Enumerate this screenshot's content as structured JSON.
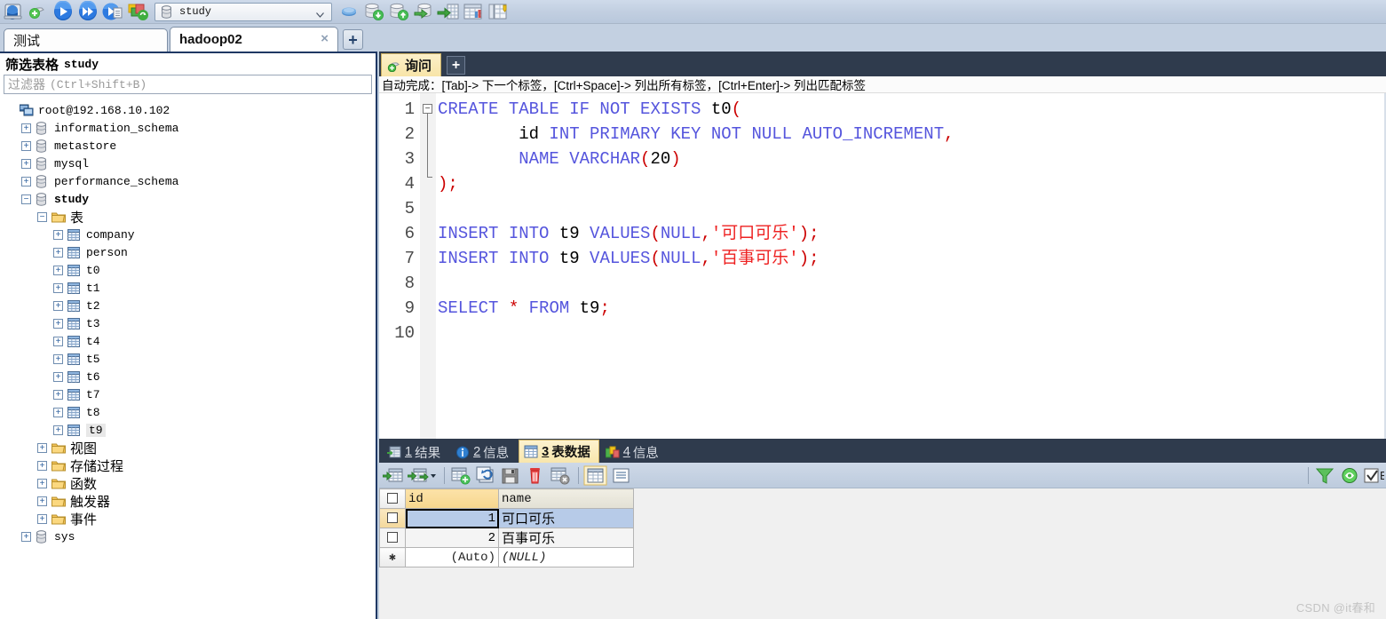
{
  "toolbar": {
    "icons": [
      {
        "name": "connection-manager-icon"
      },
      {
        "name": "new-query-icon"
      },
      {
        "name": "execute-icon"
      },
      {
        "name": "execute-all-icon"
      },
      {
        "name": "execute-selection-icon"
      },
      {
        "name": "stop-icon"
      }
    ],
    "database_selector": {
      "value": "study",
      "icon": "database-icon",
      "caret": "chevron-down-icon"
    },
    "right_icons": [
      {
        "name": "flush-icon"
      },
      {
        "name": "import-database-icon"
      },
      {
        "name": "export-database-icon"
      },
      {
        "name": "export-grid-icon"
      },
      {
        "name": "import-csv-icon"
      },
      {
        "name": "table-tools-icon"
      },
      {
        "name": "bulk-table-editor-icon"
      }
    ]
  },
  "connection_tabs": {
    "tabs": [
      {
        "label": "测试",
        "active": false,
        "closable": false
      },
      {
        "label": "hadoop02",
        "active": true,
        "closable": true,
        "close_glyph": "×"
      }
    ],
    "new_tab_label": "+"
  },
  "sidebar": {
    "title_zh": "筛选表格",
    "title_db": "study",
    "filter_placeholder_zh": "过滤器",
    "filter_placeholder_hint": "(Ctrl+Shift+B)",
    "tree": [
      {
        "label": "root@192.168.10.102",
        "icon": "server-icon",
        "indent": 0,
        "expander": "",
        "bold": false,
        "zh": false,
        "selected": false
      },
      {
        "label": "information_schema",
        "icon": "database-icon",
        "indent": 1,
        "expander": "+",
        "bold": false,
        "zh": false,
        "selected": false
      },
      {
        "label": "metastore",
        "icon": "database-icon",
        "indent": 1,
        "expander": "+",
        "bold": false,
        "zh": false,
        "selected": false
      },
      {
        "label": "mysql",
        "icon": "database-icon",
        "indent": 1,
        "expander": "+",
        "bold": false,
        "zh": false,
        "selected": false
      },
      {
        "label": "performance_schema",
        "icon": "database-icon",
        "indent": 1,
        "expander": "+",
        "bold": false,
        "zh": false,
        "selected": false
      },
      {
        "label": "study",
        "icon": "database-icon",
        "indent": 1,
        "expander": "-",
        "bold": true,
        "zh": false,
        "selected": false
      },
      {
        "label": "表",
        "icon": "folder-icon",
        "indent": 2,
        "expander": "-",
        "bold": false,
        "zh": true,
        "selected": false
      },
      {
        "label": "company",
        "icon": "table-icon",
        "indent": 3,
        "expander": "+",
        "bold": false,
        "zh": false,
        "selected": false
      },
      {
        "label": "person",
        "icon": "table-icon",
        "indent": 3,
        "expander": "+",
        "bold": false,
        "zh": false,
        "selected": false
      },
      {
        "label": "t0",
        "icon": "table-icon",
        "indent": 3,
        "expander": "+",
        "bold": false,
        "zh": false,
        "selected": false
      },
      {
        "label": "t1",
        "icon": "table-icon",
        "indent": 3,
        "expander": "+",
        "bold": false,
        "zh": false,
        "selected": false
      },
      {
        "label": "t2",
        "icon": "table-icon",
        "indent": 3,
        "expander": "+",
        "bold": false,
        "zh": false,
        "selected": false
      },
      {
        "label": "t3",
        "icon": "table-icon",
        "indent": 3,
        "expander": "+",
        "bold": false,
        "zh": false,
        "selected": false
      },
      {
        "label": "t4",
        "icon": "table-icon",
        "indent": 3,
        "expander": "+",
        "bold": false,
        "zh": false,
        "selected": false
      },
      {
        "label": "t5",
        "icon": "table-icon",
        "indent": 3,
        "expander": "+",
        "bold": false,
        "zh": false,
        "selected": false
      },
      {
        "label": "t6",
        "icon": "table-icon",
        "indent": 3,
        "expander": "+",
        "bold": false,
        "zh": false,
        "selected": false
      },
      {
        "label": "t7",
        "icon": "table-icon",
        "indent": 3,
        "expander": "+",
        "bold": false,
        "zh": false,
        "selected": false
      },
      {
        "label": "t8",
        "icon": "table-icon",
        "indent": 3,
        "expander": "+",
        "bold": false,
        "zh": false,
        "selected": false
      },
      {
        "label": "t9",
        "icon": "table-icon",
        "indent": 3,
        "expander": "+",
        "bold": false,
        "zh": false,
        "selected": true
      },
      {
        "label": "视图",
        "icon": "folder-icon",
        "indent": 2,
        "expander": "+",
        "bold": false,
        "zh": true,
        "selected": false
      },
      {
        "label": "存储过程",
        "icon": "folder-icon",
        "indent": 2,
        "expander": "+",
        "bold": false,
        "zh": true,
        "selected": false
      },
      {
        "label": "函数",
        "icon": "folder-icon",
        "indent": 2,
        "expander": "+",
        "bold": false,
        "zh": true,
        "selected": false
      },
      {
        "label": "触发器",
        "icon": "folder-icon",
        "indent": 2,
        "expander": "+",
        "bold": false,
        "zh": true,
        "selected": false
      },
      {
        "label": "事件",
        "icon": "folder-icon",
        "indent": 2,
        "expander": "+",
        "bold": false,
        "zh": true,
        "selected": false
      },
      {
        "label": "sys",
        "icon": "database-icon",
        "indent": 1,
        "expander": "+",
        "bold": false,
        "zh": false,
        "selected": false
      }
    ]
  },
  "query_area": {
    "tab_label": "询问",
    "tab_icon": "query-icon",
    "new_tab_label": "+",
    "hint": "自动完成：[Tab]-> 下一个标签，[Ctrl+Space]-> 列出所有标签，[Ctrl+Enter]-> 列出匹配标签",
    "line_numbers": [
      "1",
      "2",
      "3",
      "4",
      "5",
      "6",
      "7",
      "8",
      "9",
      "10"
    ],
    "code_lines": [
      [
        {
          "t": "CREATE TABLE IF NOT EXISTS ",
          "c": "kw"
        },
        {
          "t": "t0",
          "c": "id"
        },
        {
          "t": "(",
          "c": "pn"
        }
      ],
      [
        {
          "t": "        id ",
          "c": "id"
        },
        {
          "t": "INT PRIMARY KEY NOT NULL AUTO_INCREMENT",
          "c": "kw"
        },
        {
          "t": ",",
          "c": "pn"
        }
      ],
      [
        {
          "t": "        ",
          "c": "id"
        },
        {
          "t": "NAME VARCHAR",
          "c": "kw"
        },
        {
          "t": "(",
          "c": "pn"
        },
        {
          "t": "20",
          "c": "num"
        },
        {
          "t": ")",
          "c": "pn"
        }
      ],
      [
        {
          "t": ");",
          "c": "pn"
        }
      ],
      [],
      [
        {
          "t": "INSERT INTO ",
          "c": "kw"
        },
        {
          "t": "t9 ",
          "c": "id"
        },
        {
          "t": "VALUES",
          "c": "kw"
        },
        {
          "t": "(",
          "c": "pn"
        },
        {
          "t": "NULL",
          "c": "kw"
        },
        {
          "t": ",",
          "c": "pn"
        },
        {
          "t": "'可口可乐'",
          "c": "st"
        },
        {
          "t": ");",
          "c": "pn"
        }
      ],
      [
        {
          "t": "INSERT INTO ",
          "c": "kw"
        },
        {
          "t": "t9 ",
          "c": "id"
        },
        {
          "t": "VALUES",
          "c": "kw"
        },
        {
          "t": "(",
          "c": "pn"
        },
        {
          "t": "NULL",
          "c": "kw"
        },
        {
          "t": ",",
          "c": "pn"
        },
        {
          "t": "'百事可乐'",
          "c": "st"
        },
        {
          "t": ");",
          "c": "pn"
        }
      ],
      [],
      [
        {
          "t": "SELECT ",
          "c": "kw"
        },
        {
          "t": "* ",
          "c": "pn"
        },
        {
          "t": "FROM ",
          "c": "kw"
        },
        {
          "t": "t9",
          "c": "id"
        },
        {
          "t": ";",
          "c": "pn"
        }
      ],
      []
    ]
  },
  "results": {
    "tabs": [
      {
        "num": "1",
        "label": "结果",
        "icon": "result-grid-icon",
        "active": false
      },
      {
        "num": "2",
        "label": "信息",
        "icon": "info-icon",
        "active": false
      },
      {
        "num": "3",
        "label": "表数据",
        "icon": "table-data-icon",
        "active": true
      },
      {
        "num": "4",
        "label": "信息",
        "icon": "chart-info-icon",
        "active": false
      }
    ],
    "grid_toolbar": [
      {
        "name": "show-all-rows-icon"
      },
      {
        "name": "next-rows-icon",
        "has_caret": true
      },
      {
        "name": "insert-row-icon"
      },
      {
        "name": "revert-row-icon"
      },
      {
        "name": "save-row-icon"
      },
      {
        "name": "delete-row-icon"
      },
      {
        "name": "cancel-edit-icon"
      },
      {
        "name": "grid-view-icon",
        "active": true
      },
      {
        "name": "form-view-icon"
      }
    ],
    "grid_toolbar_right": [
      {
        "name": "filter-icon"
      },
      {
        "name": "refresh-icon"
      },
      {
        "name": "sort-checkbox-icon"
      }
    ],
    "columns": [
      "id",
      "name"
    ],
    "rows": [
      {
        "id": "1",
        "name": "可口可乐",
        "selected": true
      },
      {
        "id": "2",
        "name": "百事可乐",
        "selected": false
      },
      {
        "id": "(Auto)",
        "name": "(NULL)",
        "selected": false,
        "is_new": true
      }
    ]
  },
  "watermark": "CSDN @it春和"
}
